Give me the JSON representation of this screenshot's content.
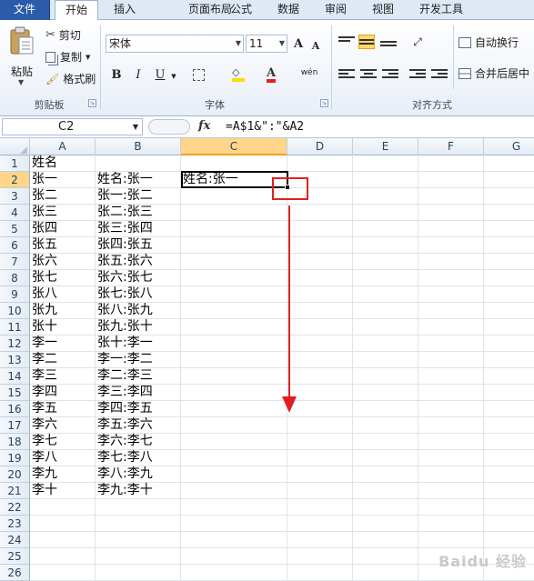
{
  "tabs": [
    {
      "label": "文件"
    },
    {
      "label": "开始"
    },
    {
      "label": "插入"
    },
    {
      "label": "页面布局"
    },
    {
      "label": "公式"
    },
    {
      "label": "数据"
    },
    {
      "label": "审阅"
    },
    {
      "label": "视图"
    },
    {
      "label": "开发工具"
    }
  ],
  "ribbon": {
    "clipboard": {
      "paste": "粘贴",
      "cut": "剪切",
      "copy": "复制",
      "format_painter": "格式刷",
      "group": "剪贴板"
    },
    "font": {
      "name": "宋体",
      "size": "11",
      "group": "字体",
      "grow": "A",
      "shrink": "A",
      "bold": "B",
      "italic": "I",
      "underline": "U",
      "wen": "wén"
    },
    "alignment": {
      "wrap_text": "自动换行",
      "merge_center": "合并后居中",
      "group": "对齐方式"
    }
  },
  "formula_bar": {
    "name_box": "C2",
    "fx": "fx",
    "formula": "=A$1&\":\"&A2"
  },
  "columns": [
    "A",
    "B",
    "C",
    "D",
    "E",
    "F",
    "G"
  ],
  "selected_column": "C",
  "selected_row": "2",
  "rows": [
    {
      "num": "1",
      "a": "姓名",
      "b": "",
      "c": ""
    },
    {
      "num": "2",
      "a": "张一",
      "b": "姓名:张一",
      "c": "姓名:张一"
    },
    {
      "num": "3",
      "a": "张二",
      "b": "张一:张二",
      "c": ""
    },
    {
      "num": "4",
      "a": "张三",
      "b": "张二:张三",
      "c": ""
    },
    {
      "num": "5",
      "a": "张四",
      "b": "张三:张四",
      "c": ""
    },
    {
      "num": "6",
      "a": "张五",
      "b": "张四:张五",
      "c": ""
    },
    {
      "num": "7",
      "a": "张六",
      "b": "张五:张六",
      "c": ""
    },
    {
      "num": "8",
      "a": "张七",
      "b": "张六:张七",
      "c": ""
    },
    {
      "num": "9",
      "a": "张八",
      "b": "张七:张八",
      "c": ""
    },
    {
      "num": "10",
      "a": "张九",
      "b": "张八:张九",
      "c": ""
    },
    {
      "num": "11",
      "a": "张十",
      "b": "张九:张十",
      "c": ""
    },
    {
      "num": "12",
      "a": "李一",
      "b": "张十:李一",
      "c": ""
    },
    {
      "num": "13",
      "a": "李二",
      "b": "李一:李二",
      "c": ""
    },
    {
      "num": "14",
      "a": "李三",
      "b": "李二:李三",
      "c": ""
    },
    {
      "num": "15",
      "a": "李四",
      "b": "李三:李四",
      "c": ""
    },
    {
      "num": "16",
      "a": "李五",
      "b": "李四:李五",
      "c": ""
    },
    {
      "num": "17",
      "a": "李六",
      "b": "李五:李六",
      "c": ""
    },
    {
      "num": "18",
      "a": "李七",
      "b": "李六:李七",
      "c": ""
    },
    {
      "num": "19",
      "a": "李八",
      "b": "李七:李八",
      "c": ""
    },
    {
      "num": "20",
      "a": "李九",
      "b": "李八:李九",
      "c": ""
    },
    {
      "num": "21",
      "a": "李十",
      "b": "李九:李十",
      "c": ""
    },
    {
      "num": "22",
      "a": "",
      "b": "",
      "c": ""
    },
    {
      "num": "23",
      "a": "",
      "b": "",
      "c": ""
    },
    {
      "num": "24",
      "a": "",
      "b": "",
      "c": ""
    },
    {
      "num": "25",
      "a": "",
      "b": "",
      "c": ""
    },
    {
      "num": "26",
      "a": "",
      "b": "",
      "c": ""
    }
  ],
  "colors": {
    "file_tab": "#2a5caa",
    "annotation": "#e02020",
    "selection_header": "#ffd58a"
  }
}
